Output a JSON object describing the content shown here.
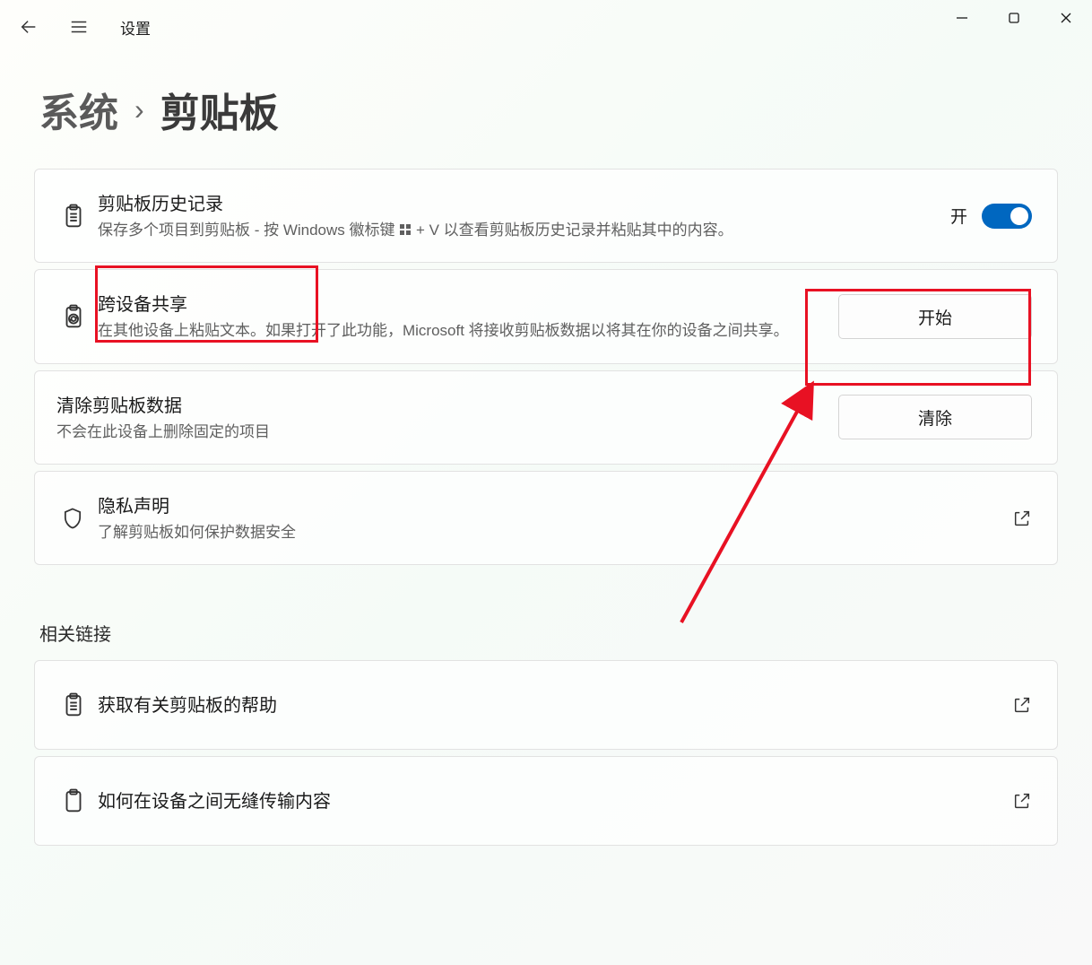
{
  "topbar": {
    "app_title": "设置"
  },
  "breadcrumb": {
    "parent": "系统",
    "current": "剪贴板"
  },
  "cards": {
    "history": {
      "title": "剪贴板历史记录",
      "desc_before": "保存多个项目到剪贴板 - 按 Windows 徽标键 ",
      "desc_after": " + V 以查看剪贴板历史记录并粘贴其中的内容。",
      "toggle_label": "开",
      "toggle_on": true
    },
    "sync": {
      "title": "跨设备共享",
      "desc": "在其他设备上粘贴文本。如果打开了此功能，Microsoft 将接收剪贴板数据以将其在你的设备之间共享。",
      "button": "开始"
    },
    "clear": {
      "title": "清除剪贴板数据",
      "desc": "不会在此设备上删除固定的项目",
      "button": "清除"
    },
    "privacy": {
      "title": "隐私声明",
      "desc": "了解剪贴板如何保护数据安全"
    }
  },
  "related": {
    "header": "相关链接",
    "help": "获取有关剪贴板的帮助",
    "transfer": "如何在设备之间无缝传输内容"
  }
}
